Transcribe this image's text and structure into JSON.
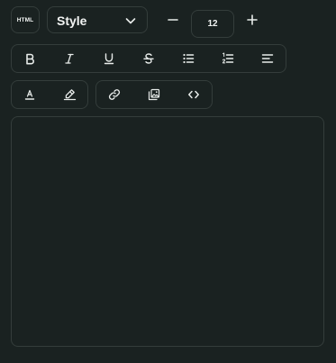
{
  "html_button_label": "HTML",
  "style_select": {
    "selected": "Style"
  },
  "font_size": {
    "value": "12"
  },
  "icons": {
    "html": "html-icon",
    "style_dropdown": "chevron-down-icon",
    "decrease": "minus-icon",
    "increase": "plus-icon",
    "bold": "bold-icon",
    "italic": "italic-icon",
    "underline": "underline-icon",
    "strikethrough": "strikethrough-icon",
    "bullet_list": "bullet-list-icon",
    "numbered_list": "numbered-list-icon",
    "align": "align-left-icon",
    "text_color": "text-color-icon",
    "highlight": "highlighter-icon",
    "link": "link-icon",
    "image": "image-icon",
    "code": "code-icon"
  },
  "colors": {
    "background": "#1a2221",
    "border": "#343d3b",
    "icon": "#e8ecea"
  }
}
